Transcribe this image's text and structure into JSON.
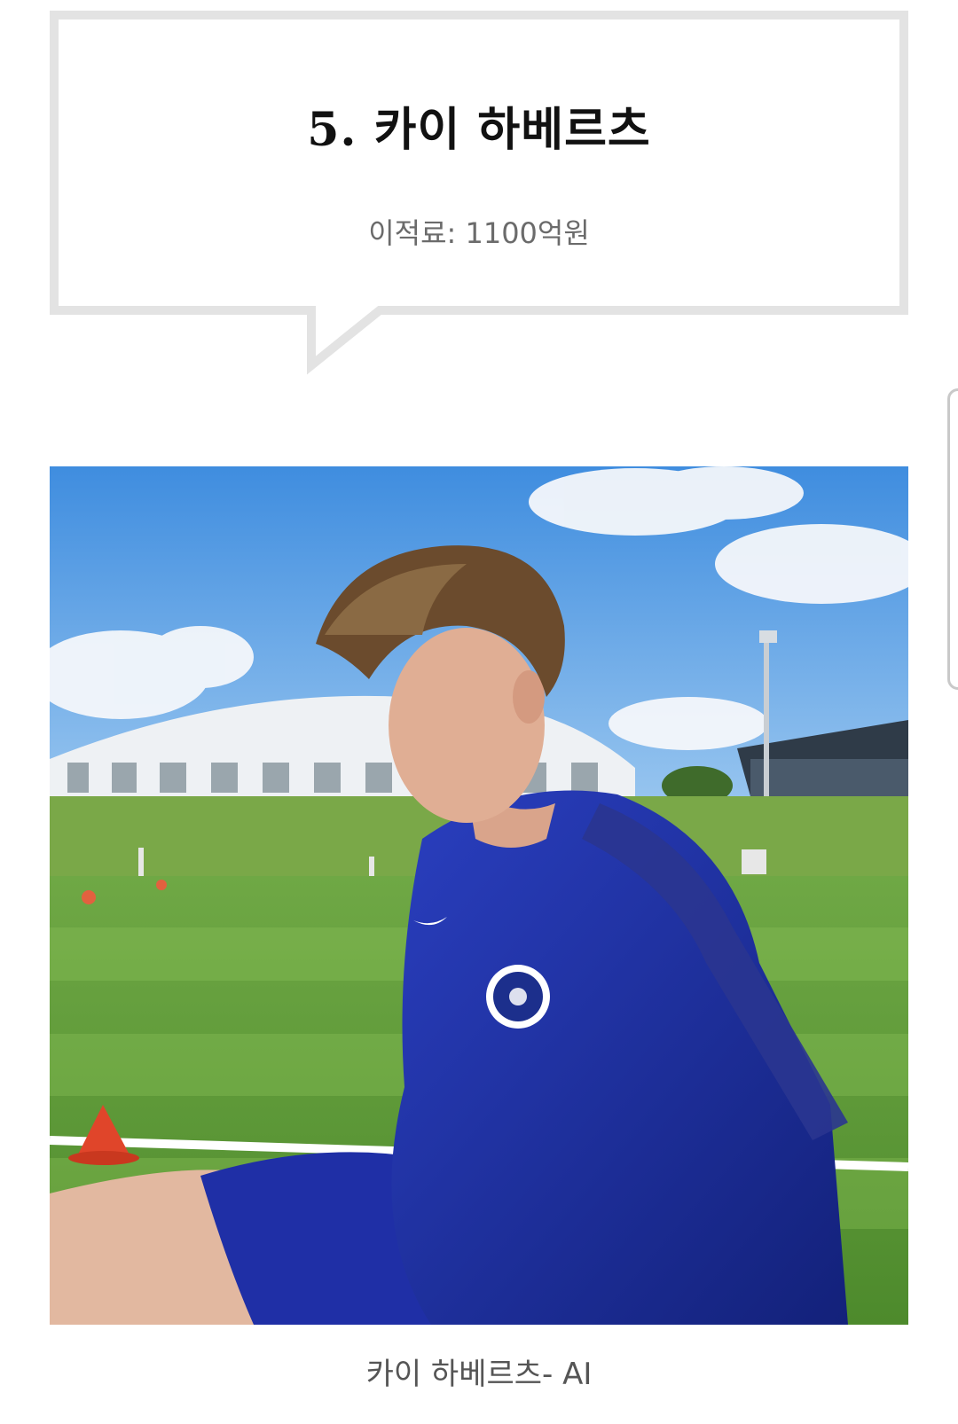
{
  "heading": {
    "title": "5. 카이 하베르츠",
    "transfer_fee": "이적료: 1100억원"
  },
  "image": {
    "caption": "카이 하베르츠- AI",
    "subject": "player-training-photo"
  },
  "colors": {
    "bubble_border": "#e3e3e3",
    "jersey": "#1e2f9e",
    "sky": "#5b9ee6",
    "pitch": "#5f9a3a"
  }
}
